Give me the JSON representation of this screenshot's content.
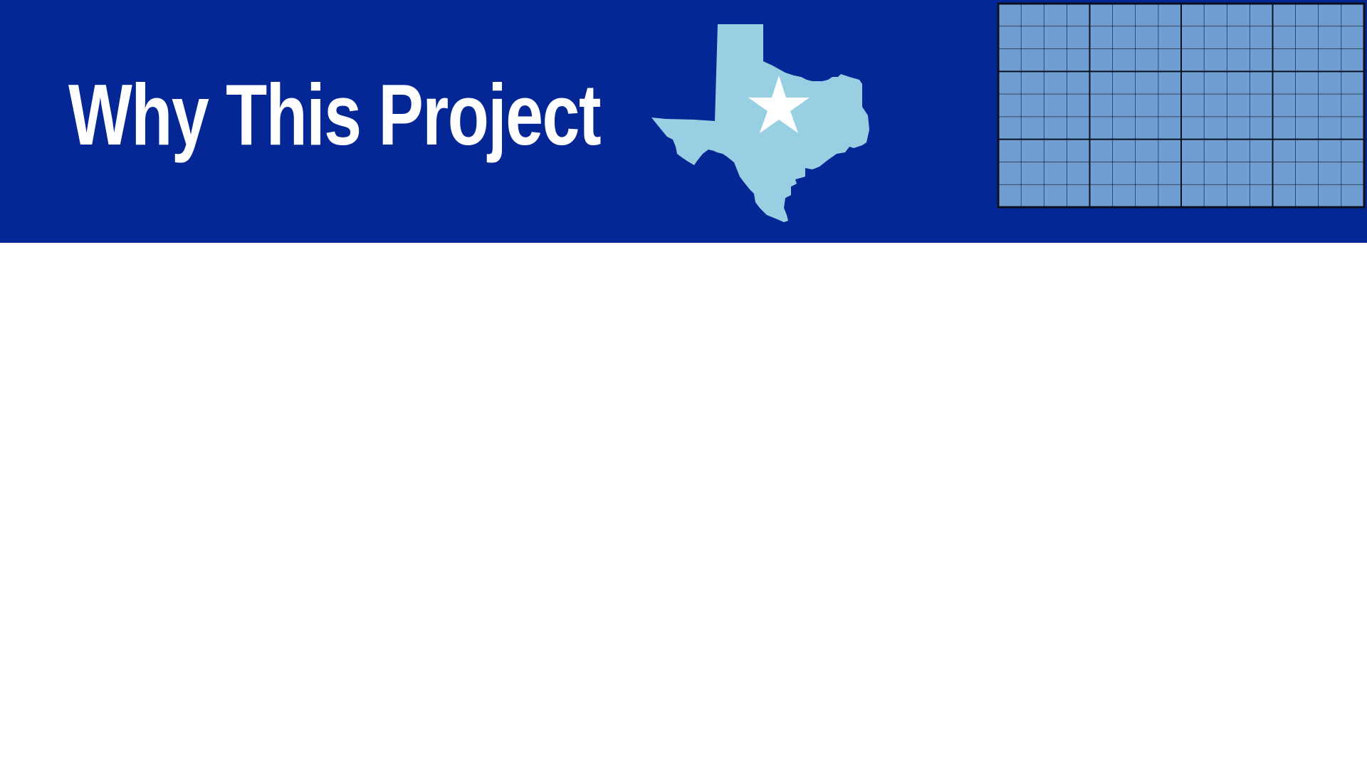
{
  "slide": {
    "title": "Why This Project",
    "colors": {
      "header_background": "#052795",
      "title_text": "#ffffff",
      "texas_fill": "#98cfe3",
      "star_fill": "#ffffff",
      "grid_fill": "#709ed2",
      "grid_lines": "#0a1020"
    },
    "icons": {
      "state_graphic": "texas-state-icon",
      "star": "star-icon",
      "grid": "grid-graphic"
    }
  }
}
